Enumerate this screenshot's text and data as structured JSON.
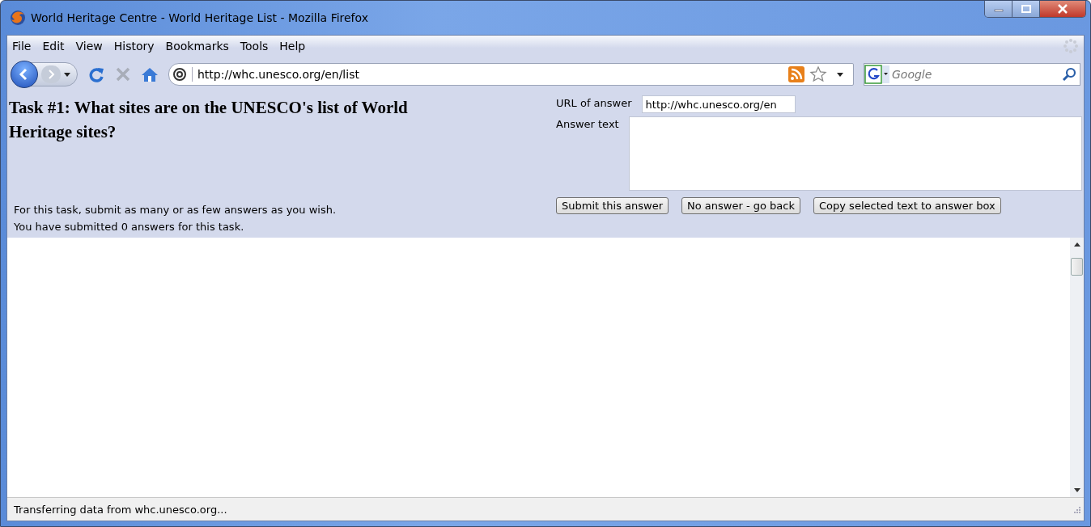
{
  "window": {
    "title": "World Heritage Centre - World Heritage List - Mozilla Firefox"
  },
  "menu": [
    "File",
    "Edit",
    "View",
    "History",
    "Bookmarks",
    "Tools",
    "Help"
  ],
  "address_bar": {
    "value": "http://whc.unesco.org/en/list"
  },
  "search": {
    "placeholder": "Google"
  },
  "task": {
    "title": "Task #1: What sites are on the UNESCO's list of World Heritage sites?",
    "instructions": "For this task, submit as many or as few answers as you wish.",
    "submitted": "You have submitted 0 answers for this task.",
    "url_label": "URL of answer",
    "url_value": "http://whc.unesco.org/en",
    "answer_label": "Answer text",
    "buttons": [
      "Submit this answer",
      "No answer - go back",
      "Copy selected text to answer box"
    ]
  },
  "status_bar": "Transferring data from whc.unesco.org..."
}
